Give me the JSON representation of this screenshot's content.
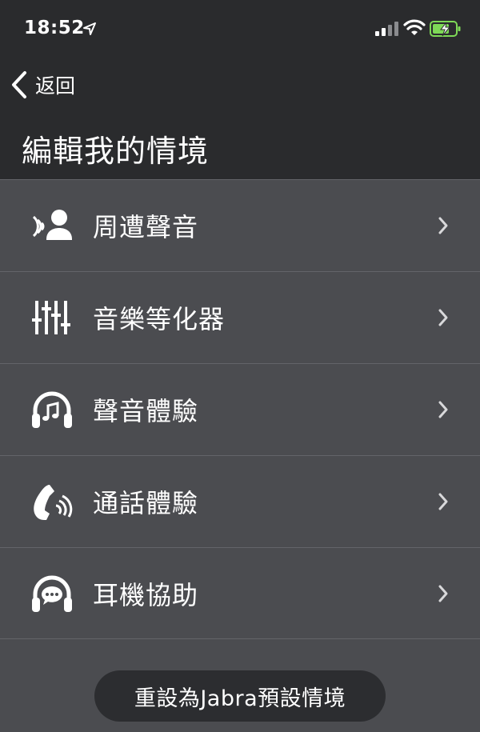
{
  "status_bar": {
    "time": "18:52"
  },
  "nav": {
    "back_label": "返回",
    "title": "編輯我的情境"
  },
  "menu": {
    "items": [
      {
        "label": "周遭聲音",
        "icon": "hear-through-person-icon"
      },
      {
        "label": "音樂等化器",
        "icon": "equalizer-sliders-icon"
      },
      {
        "label": "聲音體驗",
        "icon": "headphones-music-icon"
      },
      {
        "label": "通話體驗",
        "icon": "phone-call-icon"
      },
      {
        "label": "耳機協助",
        "icon": "headphones-chat-icon"
      }
    ]
  },
  "footer": {
    "reset_label": "重設為Jabra預設情境"
  },
  "colors": {
    "header_bg": "#2a2b2d",
    "list_bg": "#4b4c50",
    "divider": "#636469",
    "button_bg": "#2c2d30",
    "battery_green": "#7ed957"
  }
}
